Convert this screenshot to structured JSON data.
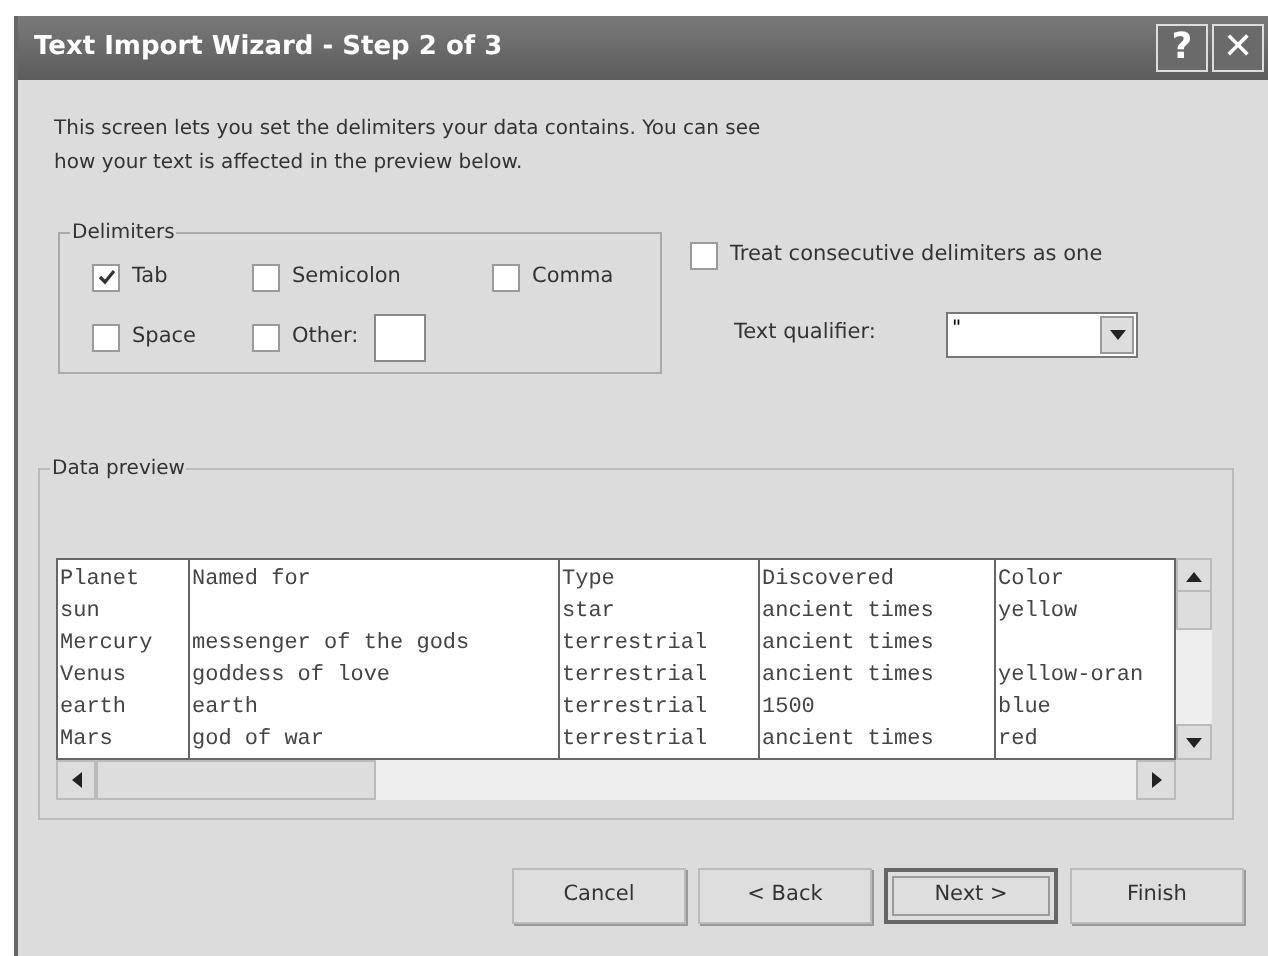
{
  "window": {
    "title": "Text Import Wizard - Step 2 of 3",
    "title_buttons": [
      "?",
      "✕"
    ]
  },
  "instructions": "This screen lets you set the delimiters your data contains.  You can see how your text is affected in the preview below.",
  "delimiters": {
    "label": "Delimiters",
    "options": [
      {
        "label": "Tab",
        "checked": true
      },
      {
        "label": "Semicolon",
        "checked": false
      },
      {
        "label": "Comma",
        "checked": false
      },
      {
        "label": "Space",
        "checked": false
      },
      {
        "label": "Other:",
        "checked": false
      }
    ]
  },
  "treat_consecutive": {
    "label": "Treat consecutive delimiters as one",
    "checked": false
  },
  "text_qualifier": {
    "label": "Text qualifier:",
    "value": "\""
  },
  "preview": {
    "label": "Data preview",
    "columns": [
      [
        "Planet",
        "sun",
        "Mercury",
        "Venus",
        "earth",
        "Mars"
      ],
      [
        "Named for",
        "",
        "messenger of the gods",
        "goddess of love",
        "earth",
        "god of war"
      ],
      [
        "Type",
        "star",
        "terrestrial",
        "terrestrial",
        "terrestrial",
        "terrestrial"
      ],
      [
        "Discovered",
        "ancient times",
        "ancient times",
        "ancient times",
        "1500",
        "ancient times"
      ],
      [
        "Color",
        "yellow",
        "",
        "yellow-oran",
        "blue",
        "red"
      ]
    ]
  },
  "buttons": [
    {
      "label": "Cancel",
      "default": false
    },
    {
      "label": "< Back",
      "default": false
    },
    {
      "label": "Next >",
      "default": true
    },
    {
      "label": "Finish",
      "default": false
    }
  ]
}
